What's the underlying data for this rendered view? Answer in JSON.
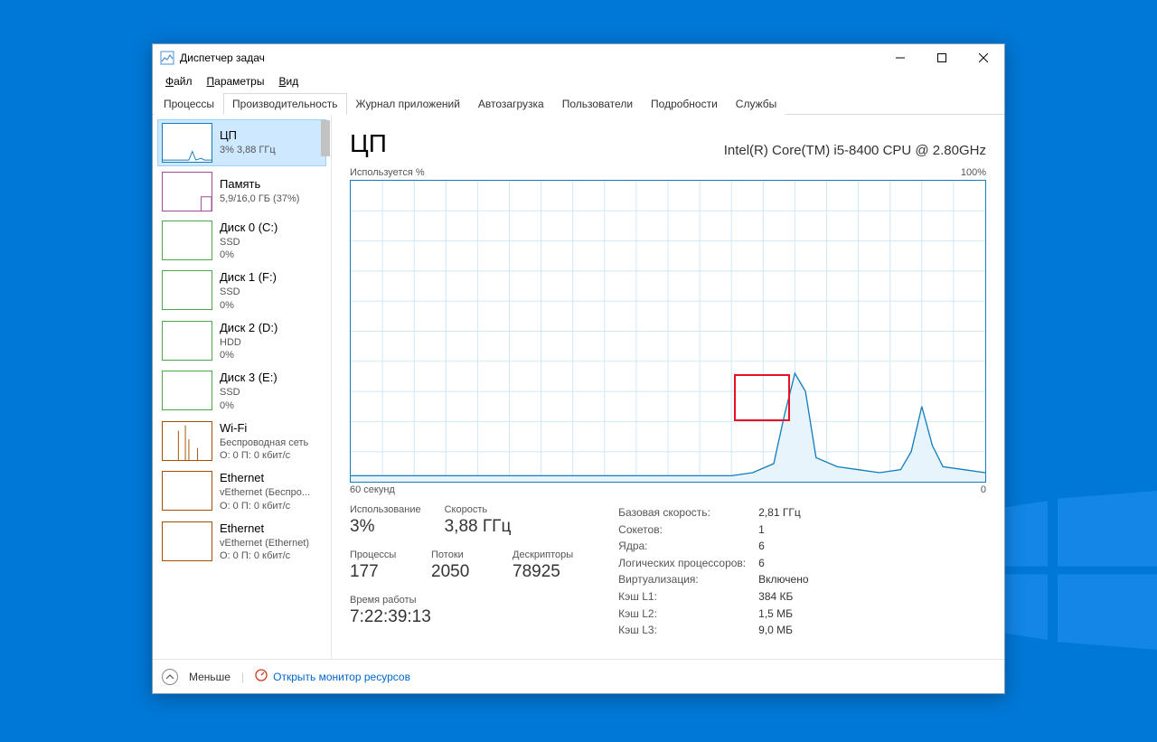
{
  "window": {
    "title": "Диспетчер задач"
  },
  "menu": {
    "file": "Файл",
    "options": "Параметры",
    "view": "Вид"
  },
  "tabs": {
    "processes": "Процессы",
    "performance": "Производительность",
    "apphistory": "Журнал приложений",
    "startup": "Автозагрузка",
    "users": "Пользователи",
    "details": "Подробности",
    "services": "Службы"
  },
  "sidebar": [
    {
      "title": "ЦП",
      "sub1": "3% 3,88 ГГц",
      "sub2": "",
      "color": "#117dbb"
    },
    {
      "title": "Память",
      "sub1": "5,9/16,0 ГБ (37%)",
      "sub2": "",
      "color": "#9b4f96"
    },
    {
      "title": "Диск 0 (C:)",
      "sub1": "SSD",
      "sub2": "0%",
      "color": "#4ca64c"
    },
    {
      "title": "Диск 1 (F:)",
      "sub1": "SSD",
      "sub2": "0%",
      "color": "#4ca64c"
    },
    {
      "title": "Диск 2 (D:)",
      "sub1": "HDD",
      "sub2": "0%",
      "color": "#4ca64c"
    },
    {
      "title": "Диск 3 (E:)",
      "sub1": "SSD",
      "sub2": "0%",
      "color": "#4ca64c"
    },
    {
      "title": "Wi-Fi",
      "sub1": "Беспроводная сеть",
      "sub2": "О: 0 П: 0 кбит/с",
      "color": "#a74f01"
    },
    {
      "title": "Ethernet",
      "sub1": "vEthernet (Беспро...",
      "sub2": "О: 0 П: 0 кбит/с",
      "color": "#a74f01"
    },
    {
      "title": "Ethernet",
      "sub1": "vEthernet (Ethernet)",
      "sub2": "О: 0 П: 0 кбит/с",
      "color": "#a74f01"
    }
  ],
  "main": {
    "title": "ЦП",
    "cpu_name": "Intel(R) Core(TM) i5-8400 CPU @ 2.80GHz",
    "chart_ylabel": "Используется %",
    "chart_ymax": "100%",
    "chart_xleft": "60 секунд",
    "chart_xright": "0"
  },
  "stats_left": {
    "util_label": "Использование",
    "util_value": "3%",
    "speed_label": "Скорость",
    "speed_value": "3,88 ГГц",
    "proc_label": "Процессы",
    "proc_value": "177",
    "thread_label": "Потоки",
    "thread_value": "2050",
    "handle_label": "Дескрипторы",
    "handle_value": "78925",
    "uptime_label": "Время работы",
    "uptime_value": "7:22:39:13"
  },
  "stats_right": [
    {
      "lbl": "Базовая скорость:",
      "val": "2,81 ГГц"
    },
    {
      "lbl": "Сокетов:",
      "val": "1"
    },
    {
      "lbl": "Ядра:",
      "val": "6"
    },
    {
      "lbl": "Логических процессоров:",
      "val": "6"
    },
    {
      "lbl": "Виртуализация:",
      "val": "Включено"
    },
    {
      "lbl": "Кэш L1:",
      "val": "384 КБ"
    },
    {
      "lbl": "Кэш L2:",
      "val": "1,5 МБ"
    },
    {
      "lbl": "Кэш L3:",
      "val": "9,0 МБ"
    }
  ],
  "footer": {
    "less": "Меньше",
    "monitor": "Открыть монитор ресурсов"
  },
  "chart_data": {
    "type": "line",
    "title": "Используется %",
    "xlabel": "60 секунд → 0",
    "ylabel": "%",
    "ylim": [
      0,
      100
    ],
    "x_seconds_ago": [
      60,
      58,
      56,
      54,
      52,
      50,
      48,
      46,
      44,
      42,
      40,
      38,
      36,
      34,
      32,
      30,
      28,
      26,
      24,
      22,
      20,
      19,
      18,
      17,
      16,
      14,
      12,
      10,
      8,
      7,
      6,
      5,
      4,
      2,
      0
    ],
    "values": [
      2,
      2,
      2,
      2,
      2,
      2,
      2,
      2,
      2,
      2,
      2,
      2,
      2,
      2,
      2,
      2,
      2,
      2,
      2,
      3,
      6,
      22,
      36,
      30,
      8,
      5,
      4,
      3,
      4,
      10,
      25,
      12,
      5,
      4,
      3
    ]
  }
}
